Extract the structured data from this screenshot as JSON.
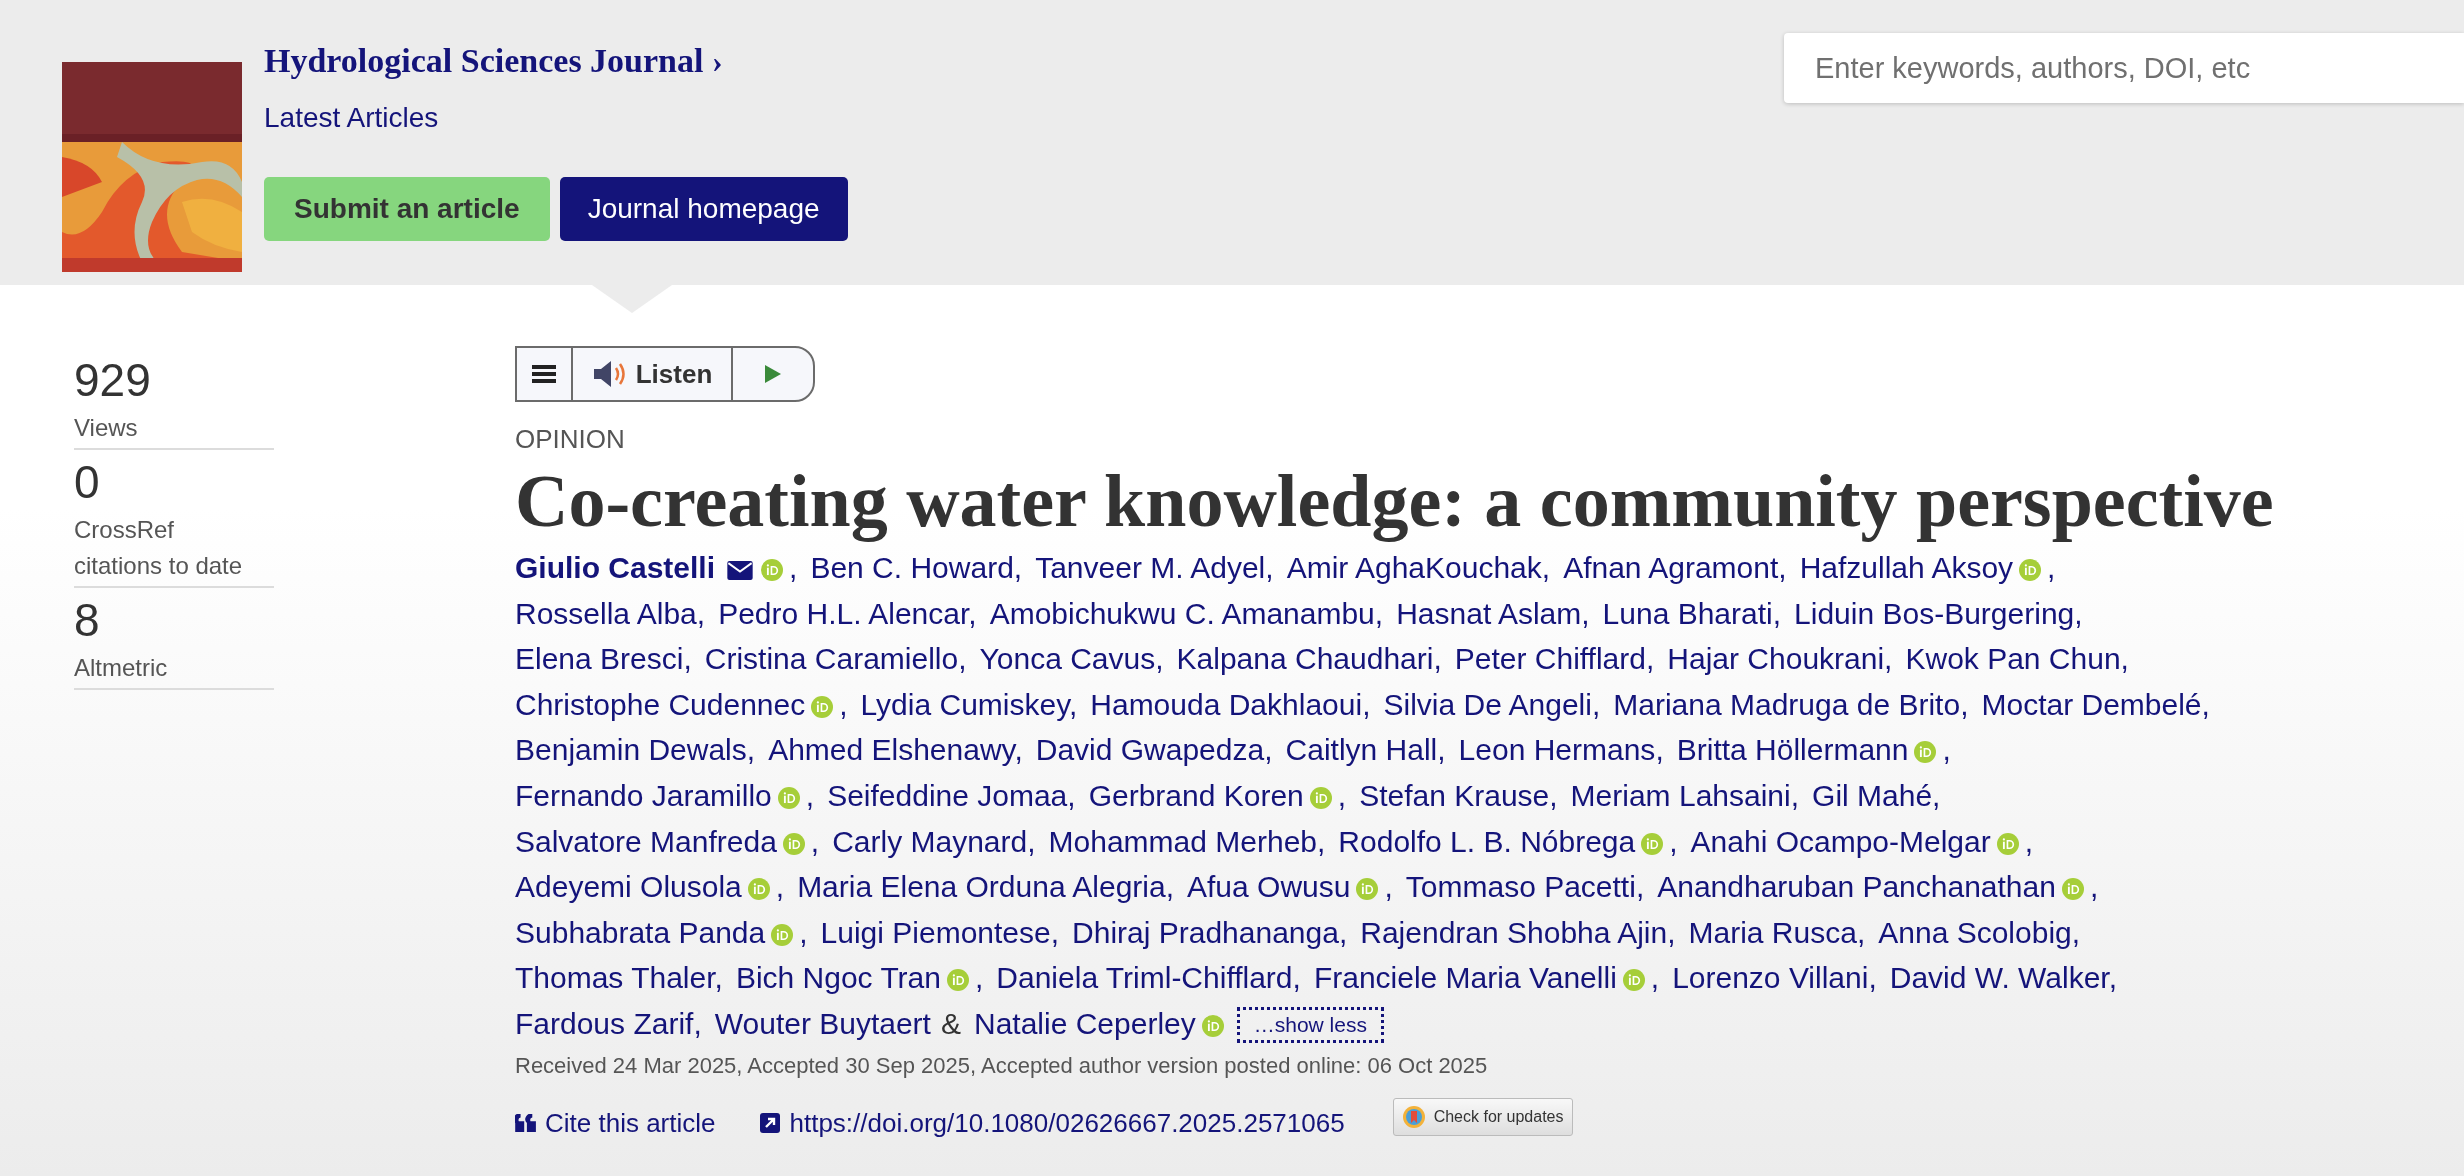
{
  "journal": {
    "title": "Hydrological Sciences Journal",
    "chevron": "›",
    "subtitle": "Latest Articles",
    "buttons": [
      {
        "label": "Submit an article",
        "kind": "secondary"
      },
      {
        "label": "Journal homepage",
        "kind": "primary"
      }
    ]
  },
  "search": {
    "placeholder": "Enter keywords, authors, DOI, etc"
  },
  "metrics": [
    {
      "value": "929",
      "label": "Views"
    },
    {
      "value": "0",
      "label": "CrossRef citations to date"
    },
    {
      "value": "8",
      "label": "Altmetric"
    }
  ],
  "listen": {
    "label": "Listen"
  },
  "article": {
    "type": "OPINION",
    "title": "Co-creating water knowledge: a community perspective",
    "author_lines": [
      [
        {
          "name": "Giulio Castelli",
          "email": true,
          "orcid": true,
          "sep": ","
        },
        {
          "name": "Ben C. Howard",
          "email": false,
          "orcid": false,
          "sep": ","
        },
        {
          "name": "Tanveer M. Adyel",
          "email": false,
          "orcid": false,
          "sep": ","
        },
        {
          "name": "Amir AghaKouchak",
          "email": false,
          "orcid": false,
          "sep": ","
        },
        {
          "name": "Afnan Agramont",
          "email": false,
          "orcid": false,
          "sep": ","
        },
        {
          "name": "Hafzullah Aksoy",
          "email": false,
          "orcid": true,
          "sep": ","
        }
      ],
      [
        {
          "name": "Rossella Alba",
          "email": false,
          "orcid": false,
          "sep": ","
        },
        {
          "name": "Pedro H.L. Alencar",
          "email": false,
          "orcid": false,
          "sep": ","
        },
        {
          "name": "Amobichukwu C. Amanambu",
          "email": false,
          "orcid": false,
          "sep": ","
        },
        {
          "name": "Hasnat Aslam",
          "email": false,
          "orcid": false,
          "sep": ","
        },
        {
          "name": "Luna Bharati",
          "email": false,
          "orcid": false,
          "sep": ","
        },
        {
          "name": "Liduin Bos-Burgering",
          "email": false,
          "orcid": false,
          "sep": ","
        }
      ],
      [
        {
          "name": "Elena Bresci",
          "email": false,
          "orcid": false,
          "sep": ","
        },
        {
          "name": "Cristina Caramiello",
          "email": false,
          "orcid": false,
          "sep": ","
        },
        {
          "name": "Yonca Cavus",
          "email": false,
          "orcid": false,
          "sep": ","
        },
        {
          "name": "Kalpana Chaudhari",
          "email": false,
          "orcid": false,
          "sep": ","
        },
        {
          "name": "Peter Chifflard",
          "email": false,
          "orcid": false,
          "sep": ","
        },
        {
          "name": "Hajar Choukrani",
          "email": false,
          "orcid": false,
          "sep": ","
        },
        {
          "name": "Kwok Pan Chun",
          "email": false,
          "orcid": false,
          "sep": ","
        }
      ],
      [
        {
          "name": "Christophe Cudennec",
          "email": false,
          "orcid": true,
          "sep": ","
        },
        {
          "name": "Lydia Cumiskey",
          "email": false,
          "orcid": false,
          "sep": ","
        },
        {
          "name": "Hamouda Dakhlaoui",
          "email": false,
          "orcid": false,
          "sep": ","
        },
        {
          "name": "Silvia De Angeli",
          "email": false,
          "orcid": false,
          "sep": ","
        },
        {
          "name": "Mariana Madruga de Brito",
          "email": false,
          "orcid": false,
          "sep": ","
        },
        {
          "name": "Moctar Dembelé",
          "email": false,
          "orcid": false,
          "sep": ","
        }
      ],
      [
        {
          "name": "Benjamin Dewals",
          "email": false,
          "orcid": false,
          "sep": ","
        },
        {
          "name": "Ahmed Elshenawy",
          "email": false,
          "orcid": false,
          "sep": ","
        },
        {
          "name": "David Gwapedza",
          "email": false,
          "orcid": false,
          "sep": ","
        },
        {
          "name": "Caitlyn Hall",
          "email": false,
          "orcid": false,
          "sep": ","
        },
        {
          "name": "Leon Hermans",
          "email": false,
          "orcid": false,
          "sep": ","
        },
        {
          "name": "Britta Höllermann",
          "email": false,
          "orcid": true,
          "sep": ","
        }
      ],
      [
        {
          "name": "Fernando Jaramillo",
          "email": false,
          "orcid": true,
          "sep": ","
        },
        {
          "name": "Seifeddine Jomaa",
          "email": false,
          "orcid": false,
          "sep": ","
        },
        {
          "name": "Gerbrand Koren",
          "email": false,
          "orcid": true,
          "sep": ","
        },
        {
          "name": "Stefan Krause",
          "email": false,
          "orcid": false,
          "sep": ","
        },
        {
          "name": "Meriam Lahsaini",
          "email": false,
          "orcid": false,
          "sep": ","
        },
        {
          "name": "Gil Mahé",
          "email": false,
          "orcid": false,
          "sep": ","
        }
      ],
      [
        {
          "name": "Salvatore Manfreda",
          "email": false,
          "orcid": true,
          "sep": ","
        },
        {
          "name": "Carly Maynard",
          "email": false,
          "orcid": false,
          "sep": ","
        },
        {
          "name": "Mohammad Merheb",
          "email": false,
          "orcid": false,
          "sep": ","
        },
        {
          "name": "Rodolfo L. B. Nóbrega",
          "email": false,
          "orcid": true,
          "sep": ","
        },
        {
          "name": "Anahi Ocampo-Melgar",
          "email": false,
          "orcid": true,
          "sep": ","
        }
      ],
      [
        {
          "name": "Adeyemi Olusola",
          "email": false,
          "orcid": true,
          "sep": ","
        },
        {
          "name": "Maria Elena Orduna Alegria",
          "email": false,
          "orcid": false,
          "sep": ","
        },
        {
          "name": "Afua Owusu",
          "email": false,
          "orcid": true,
          "sep": ","
        },
        {
          "name": "Tommaso Pacetti",
          "email": false,
          "orcid": false,
          "sep": ","
        },
        {
          "name": "Anandharuban Panchanathan",
          "email": false,
          "orcid": true,
          "sep": ","
        }
      ],
      [
        {
          "name": "Subhabrata Panda",
          "email": false,
          "orcid": true,
          "sep": ","
        },
        {
          "name": "Luigi Piemontese",
          "email": false,
          "orcid": false,
          "sep": ","
        },
        {
          "name": "Dhiraj Pradhananga",
          "email": false,
          "orcid": false,
          "sep": ","
        },
        {
          "name": "Rajendran Shobha Ajin",
          "email": false,
          "orcid": false,
          "sep": ","
        },
        {
          "name": "Maria Rusca",
          "email": false,
          "orcid": false,
          "sep": ","
        },
        {
          "name": "Anna Scolobig",
          "email": false,
          "orcid": false,
          "sep": ","
        }
      ],
      [
        {
          "name": "Thomas Thaler",
          "email": false,
          "orcid": false,
          "sep": ","
        },
        {
          "name": "Bich Ngoc Tran",
          "email": false,
          "orcid": true,
          "sep": ","
        },
        {
          "name": "Daniela Triml-Chifflard",
          "email": false,
          "orcid": false,
          "sep": ","
        },
        {
          "name": "Franciele Maria Vanelli",
          "email": false,
          "orcid": true,
          "sep": ","
        },
        {
          "name": "Lorenzo Villani",
          "email": false,
          "orcid": false,
          "sep": ","
        },
        {
          "name": "David W. Walker",
          "email": false,
          "orcid": false,
          "sep": ","
        }
      ],
      [
        {
          "name": "Fardous Zarif",
          "email": false,
          "orcid": false,
          "sep": ","
        },
        {
          "name": "Wouter Buytaert",
          "email": false,
          "orcid": false,
          "sep": "&"
        },
        {
          "name": "Natalie Ceperley",
          "email": false,
          "orcid": true
        }
      ]
    ],
    "show_less": "…show less",
    "history": "Received 24 Mar 2025, Accepted 30 Sep 2025, Accepted author version posted online: 06 Oct 2025",
    "cite": "Cite this article",
    "doi": "https://doi.org/10.1080/02626667.2025.2571065",
    "check_updates": "Check for updates"
  }
}
